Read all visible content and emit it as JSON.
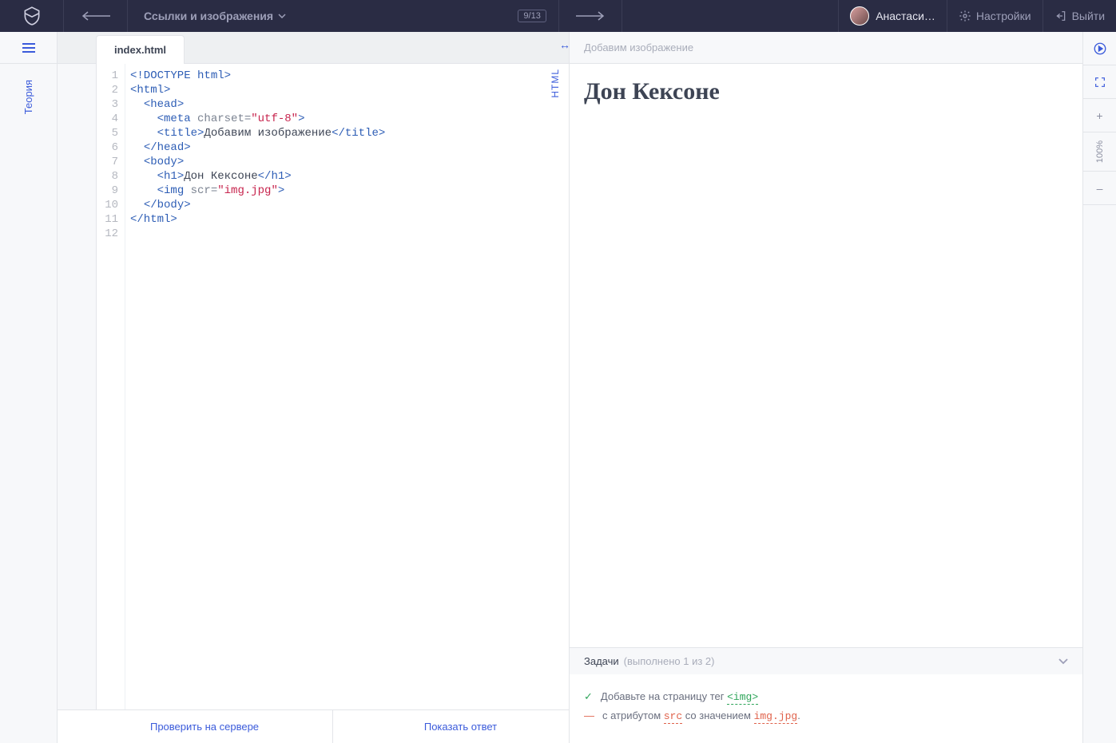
{
  "header": {
    "lesson_title": "Ссылки и изображения",
    "progress": "9/13",
    "user_name": "Анастаси…",
    "settings_label": "Настройки",
    "exit_label": "Выйти"
  },
  "theory": {
    "label": "Теория"
  },
  "editor": {
    "tab": "index.html",
    "lang_label": "HTML",
    "line_numbers": [
      "1",
      "2",
      "3",
      "4",
      "5",
      "6",
      "7",
      "8",
      "9",
      "10",
      "11",
      "12"
    ],
    "tokens": [
      [
        {
          "c": "tag",
          "t": "<!DOCTYPE html>"
        }
      ],
      [
        {
          "c": "tag",
          "t": "<html>"
        }
      ],
      [
        {
          "c": "",
          "t": "  "
        },
        {
          "c": "tag",
          "t": "<head>"
        }
      ],
      [
        {
          "c": "",
          "t": "    "
        },
        {
          "c": "tag",
          "t": "<meta"
        },
        {
          "c": "",
          "t": " "
        },
        {
          "c": "attr",
          "t": "charset="
        },
        {
          "c": "str",
          "t": "\"utf-8\""
        },
        {
          "c": "tag",
          "t": ">"
        }
      ],
      [
        {
          "c": "",
          "t": "    "
        },
        {
          "c": "tag",
          "t": "<title>"
        },
        {
          "c": "",
          "t": "Добавим изображение"
        },
        {
          "c": "tag",
          "t": "</title>"
        }
      ],
      [
        {
          "c": "",
          "t": "  "
        },
        {
          "c": "tag",
          "t": "</head>"
        }
      ],
      [
        {
          "c": "",
          "t": "  "
        },
        {
          "c": "tag",
          "t": "<body>"
        }
      ],
      [
        {
          "c": "",
          "t": "    "
        },
        {
          "c": "tag",
          "t": "<h1>"
        },
        {
          "c": "",
          "t": "Дон Кексоне"
        },
        {
          "c": "tag",
          "t": "</h1>"
        }
      ],
      [
        {
          "c": "",
          "t": "    "
        },
        {
          "c": "tag",
          "t": "<img"
        },
        {
          "c": "",
          "t": " "
        },
        {
          "c": "attr",
          "t": "scr="
        },
        {
          "c": "str",
          "t": "\"img.jpg\""
        },
        {
          "c": "tag",
          "t": ">"
        }
      ],
      [
        {
          "c": "",
          "t": "  "
        },
        {
          "c": "tag",
          "t": "</body>"
        }
      ],
      [
        {
          "c": "tag",
          "t": "</html>"
        }
      ],
      []
    ],
    "footer": {
      "check": "Проверить на сервере",
      "answer": "Показать ответ"
    }
  },
  "preview": {
    "title_bar": "Добавим изображение",
    "h1": "Дон Кексоне"
  },
  "tasks": {
    "label": "Задачи",
    "count_text": "(выполнено 1 из 2)",
    "items": [
      {
        "status": "ok",
        "mark": "✓",
        "prefix": "Добавьте на страницу тег ",
        "chip": "<img>",
        "suffix": ""
      },
      {
        "status": "fail",
        "mark": "—",
        "prefix": "с атрибутом ",
        "chip": "src",
        "mid": " со значением ",
        "chip2": "img.jpg",
        "suffix": "."
      }
    ]
  },
  "tools": {
    "zoom": "100%",
    "plus": "+",
    "minus": "–"
  }
}
